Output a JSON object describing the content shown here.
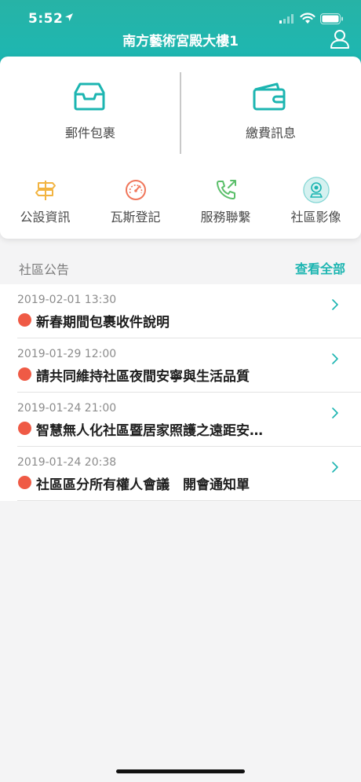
{
  "status_bar": {
    "time": "5:52"
  },
  "header": {
    "title": "南方藝術宮殿大樓1",
    "user_icon": "user-icon"
  },
  "main_actions": [
    {
      "label": "郵件包裹",
      "icon": "inbox-icon"
    },
    {
      "label": "繳費訊息",
      "icon": "wallet-icon"
    }
  ],
  "quick_actions": [
    {
      "label": "公設資訊",
      "icon": "signpost-icon",
      "color": "#f2b441"
    },
    {
      "label": "瓦斯登記",
      "icon": "gauge-icon",
      "color": "#f0765a"
    },
    {
      "label": "服務聯繫",
      "icon": "phone-icon",
      "color": "#5bbf6a"
    },
    {
      "label": "社區影像",
      "icon": "camera-icon",
      "color": "#1cb5b1"
    }
  ],
  "announcements": {
    "title": "社區公告",
    "view_all": "查看全部",
    "items": [
      {
        "date": "2019-02-01 13:30",
        "text": "新春期間包裹收件說明"
      },
      {
        "date": "2019-01-29 12:00",
        "text": "請共同維持社區夜間安寧與生活品質"
      },
      {
        "date": "2019-01-24 21:00",
        "text": "智慧無人化社區暨居家照護之遠距安…"
      },
      {
        "date": "2019-01-24 20:38",
        "text": "社區區分所有權人會議　開會通知單"
      }
    ]
  },
  "colors": {
    "accent": "#1cb5b1",
    "dot": "#ef5a45"
  }
}
